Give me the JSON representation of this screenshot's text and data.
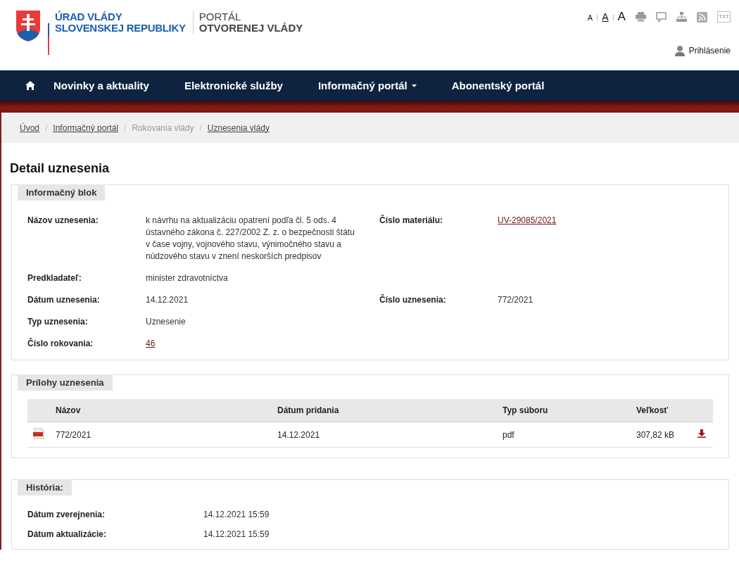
{
  "header": {
    "logo_line1": "ÚRAD VLÁDY",
    "logo_line2": "SLOVENSKEJ REPUBLIKY",
    "portal_line1": "PORTÁL",
    "portal_line2": "OTVORENEJ VLÁDY",
    "font_sizes": [
      {
        "label": "A",
        "kind": "small",
        "selected": false
      },
      {
        "label": "A",
        "kind": "medium",
        "selected": true
      },
      {
        "label": "A",
        "kind": "large",
        "selected": false
      }
    ],
    "tools": [
      {
        "kind": "print"
      },
      {
        "kind": "comment"
      },
      {
        "kind": "sitemap"
      },
      {
        "kind": "rss"
      },
      {
        "kind": "txt",
        "label": "TXT"
      }
    ],
    "login": "Prihlásenie"
  },
  "nav": {
    "items": [
      {
        "label": "Novinky a aktuality",
        "dropdown": false
      },
      {
        "label": "Elektronické služby",
        "dropdown": false
      },
      {
        "label": "Informačný portál",
        "dropdown": true
      },
      {
        "label": "Abonentský portál",
        "dropdown": false
      }
    ]
  },
  "breadcrumbs": [
    {
      "label": "Úvod",
      "link": true
    },
    {
      "separator": "/",
      "label": "Informačný portál",
      "link": true
    },
    {
      "separator": "/",
      "label": "Rokovania vlády",
      "link": false
    },
    {
      "separator": "/",
      "label": "Uznesenia vlády",
      "link": true
    }
  ],
  "title": "Detail uznesenia",
  "info_block": {
    "title": "Informačný blok",
    "rows": [
      [
        {
          "label": "Názov uznesenia:",
          "value": "k návrhu na aktualizáciu opatrení podľa čl. 5 ods. 4 ústavného zákona č. 227/2002 Z. z. o bezpečnosti štátu v čase vojny, vojnového stavu, výnimočného stavu a núdzového stavu v znení neskorších predpisov",
          "link": false
        },
        {
          "label": "Číslo materiálu:",
          "value": "UV-29085/2021",
          "link": true
        }
      ],
      [
        {
          "label": "Predkladateľ:",
          "value": "minister zdravotníctva",
          "link": false
        }
      ],
      [
        {
          "label": "Dátum uznesenia:",
          "value": "14.12.2021",
          "link": false
        },
        {
          "label": "Číslo uznesenia:",
          "value": "772/2021",
          "link": false
        }
      ],
      [
        {
          "label": "Typ uznesenia:",
          "value": "Uznesenie",
          "link": false
        }
      ],
      [
        {
          "label": "Číslo rokovania:",
          "value": "46",
          "link": true
        }
      ]
    ]
  },
  "attachments": {
    "title": "Prílohy uznesenia",
    "columns": [
      "Názov",
      "Dátum pridania",
      "Typ súboru",
      "Veľkosť"
    ],
    "rows": [
      {
        "name": "772/2021",
        "date": "14.12.2021",
        "type": "pdf",
        "size": "307,82 kB"
      }
    ]
  },
  "history": {
    "title": "História:",
    "rows": [
      {
        "label": "Dátum zverejnenia:",
        "value": "14.12.2021 15:59"
      },
      {
        "label": "Dátum aktualizácie:",
        "value": "14.12.2021 15:59"
      }
    ]
  }
}
